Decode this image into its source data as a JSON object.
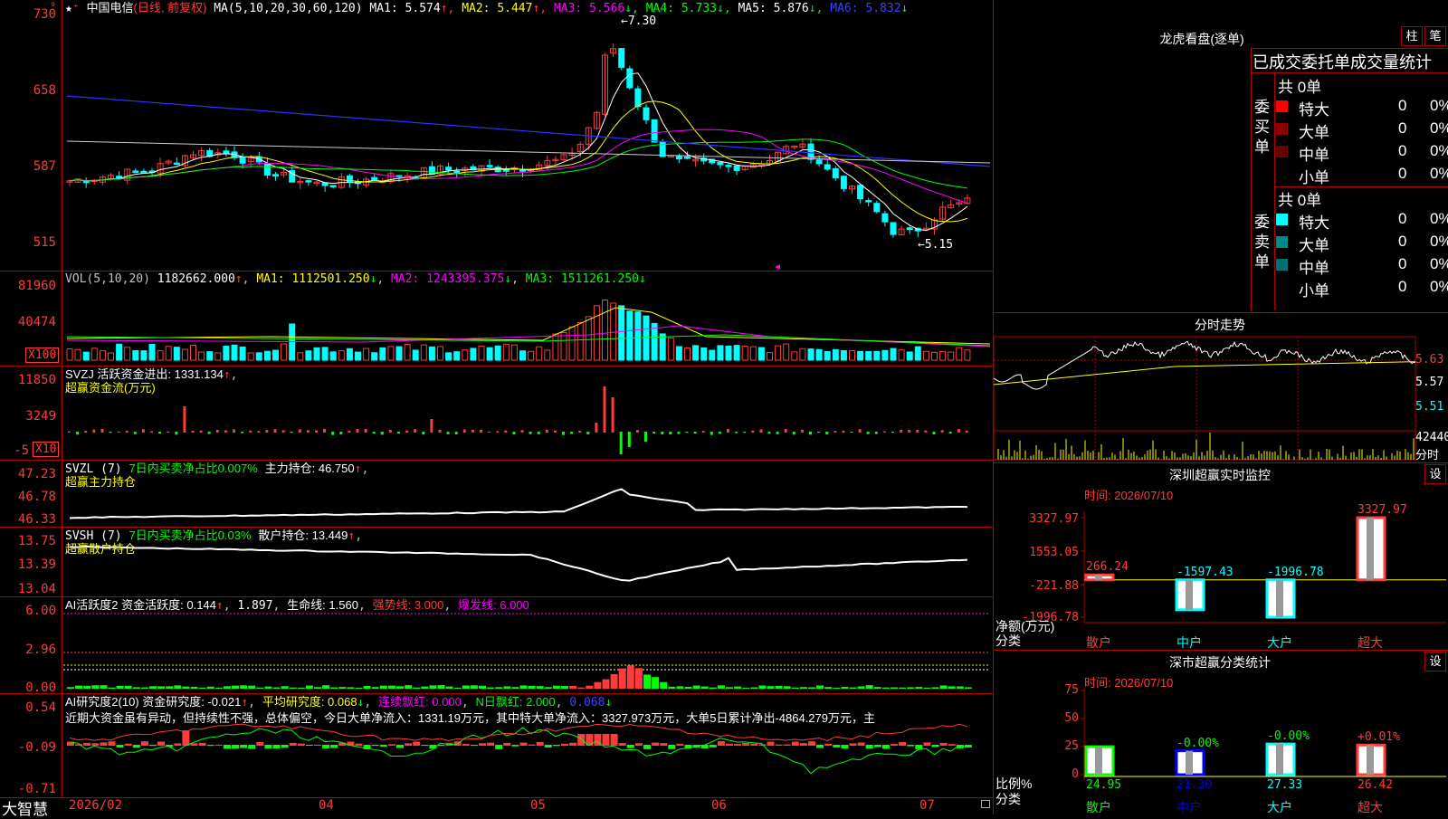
{
  "stock": {
    "name": "中国电信",
    "period": "(日线, 前复权)"
  },
  "main_ma": {
    "label": "MA(5,10,20,30,60,120)",
    "items": [
      {
        "text": "MA1: 5.574",
        "arrow": "↑",
        "color": "#ffffff"
      },
      {
        "text": "MA2: 5.447",
        "arrow": "↑",
        "color": "#ffff00"
      },
      {
        "text": "MA3: 5.566",
        "arrow": "↓",
        "color": "#ff00ff"
      },
      {
        "text": "MA4: 5.733",
        "arrow": "↓",
        "color": "#00ff00"
      },
      {
        "text": "MA5: 5.876",
        "arrow": "↓",
        "color": "#ffffff"
      },
      {
        "text": "MA6: 5.832",
        "arrow": "↓",
        "color": "#4040ff"
      }
    ],
    "yticks": [
      "730",
      "658",
      "587",
      "515"
    ],
    "high_label": "7.30",
    "low_label": "5.15"
  },
  "vol": {
    "label": "VOL(5,10,20)",
    "value": "1182662.000",
    "ma1": "MA1: 1112501.250",
    "ma2": "MA2: 1243395.375",
    "ma3": "MA3: 1511261.250",
    "yticks": [
      "81960",
      "40474"
    ],
    "unit": "X100"
  },
  "svzj": {
    "label": "SVZJ  活跃资金进出: 1331.134",
    "sub": "超赢资金流(万元)",
    "yticks": [
      "11850",
      "3249",
      "-5"
    ],
    "unit": "X10"
  },
  "svzl": {
    "label": "SVZL (7)",
    "part1": "7日内买卖净占比0.007%",
    "part2": "主力持仓: 46.750",
    "sub": "超赢主力持仓",
    "yticks": [
      "47.23",
      "46.78",
      "46.33"
    ]
  },
  "svsh": {
    "label": "SVSH (7)",
    "part1": "7日内买卖净占比0.03%",
    "part2": "散户持仓: 13.449",
    "sub": "超赢散户持仓",
    "yticks": [
      "13.75",
      "13.39",
      "13.04"
    ]
  },
  "ai1": {
    "label": "AI活跃度2 资金活跃度: 0.144",
    "v2": "1.897",
    "v3": "生命线: 1.560",
    "v4": "强势线: 3.000",
    "v5": "爆发线: 6.000",
    "yticks": [
      "6.00",
      "2.96",
      "0.00"
    ]
  },
  "ai2": {
    "label": "AI研究度2(10) 资金研究度: -0.021",
    "v2": "平均研究度: 0.068",
    "v3": "连续飘红: 0.000",
    "v4": "N日飘红: 2.000",
    "v5": "0.068",
    "comment": "近期大资金虽有异动，但持续性不强，总体偏空，今日大单净流入：1331.19万元，其中特大单净流入：3327.973万元，大单5日累计净出-4864.279万元，主",
    "yticks": [
      "0.54",
      "-0.09",
      "-0.71"
    ]
  },
  "xaxis": {
    "labels": [
      "2026/02",
      "04",
      "05",
      "06",
      "07"
    ],
    "brand": "大智慧"
  },
  "right": {
    "lh_title": "龙虎看盘(逐单)",
    "btn1": "柱",
    "btn2": "笔",
    "stat_title": "已成交委托单成交量统计",
    "buy": {
      "side": "委买单",
      "total": "共 0单",
      "rows": [
        {
          "name": "特大",
          "v": "0",
          "p": "0%",
          "color": "#ff0000"
        },
        {
          "name": "大单",
          "v": "0",
          "p": "0%",
          "color": "#8b0000"
        },
        {
          "name": "中单",
          "v": "0",
          "p": "0%",
          "color": "#6b0000"
        },
        {
          "name": "小单",
          "v": "0",
          "p": "0%",
          "color": "#000000"
        }
      ]
    },
    "sell": {
      "side": "委卖单",
      "total": "共 0单",
      "rows": [
        {
          "name": "特大",
          "v": "0",
          "p": "0%",
          "color": "#00ffff"
        },
        {
          "name": "大单",
          "v": "0",
          "p": "0%",
          "color": "#008b8b"
        },
        {
          "name": "中单",
          "v": "0",
          "p": "0%",
          "color": "#007070"
        },
        {
          "name": "小单",
          "v": "0",
          "p": "0%",
          "color": "#000000"
        }
      ]
    },
    "intraday": {
      "title": "分时走势",
      "yticks": [
        "5.63",
        "5.57",
        "5.51"
      ],
      "vol": "42440",
      "vol_unit": "分时"
    },
    "monitor": {
      "title": "深圳超赢实时监控",
      "btn": "设",
      "time": "时间: 2026/07/10",
      "yticks": [
        "3327.97",
        "1553.05",
        "-221.88",
        "-1996.78"
      ],
      "ylabel1": "净额(万元)",
      "ylabel2": "分类",
      "bars": [
        {
          "cat": "散户",
          "value": 266.24,
          "label": "266.24"
        },
        {
          "cat": "中户",
          "value": -1597.43,
          "label": "-1597.43"
        },
        {
          "cat": "大户",
          "value": -1996.78,
          "label": "-1996.78"
        },
        {
          "cat": "超大",
          "value": 3327.97,
          "label": "3327.97"
        }
      ]
    },
    "stats": {
      "title": "深市超赢分类统计",
      "btn": "设",
      "time": "时间: 2026/07/10",
      "yticks": [
        "75",
        "50",
        "25",
        "0"
      ],
      "ylabel1": "比例%",
      "ylabel2": "分类",
      "bars": [
        {
          "cat": "散户",
          "value": 24.95,
          "label": "24.95",
          "change": ""
        },
        {
          "cat": "中户",
          "value": 21.3,
          "label": "21.30",
          "change": "-0.00%"
        },
        {
          "cat": "大户",
          "value": 27.33,
          "label": "27.33",
          "change": "-0.00%"
        },
        {
          "cat": "超大",
          "value": 26.42,
          "label": "26.42",
          "change": "+0.01%"
        }
      ]
    }
  }
}
